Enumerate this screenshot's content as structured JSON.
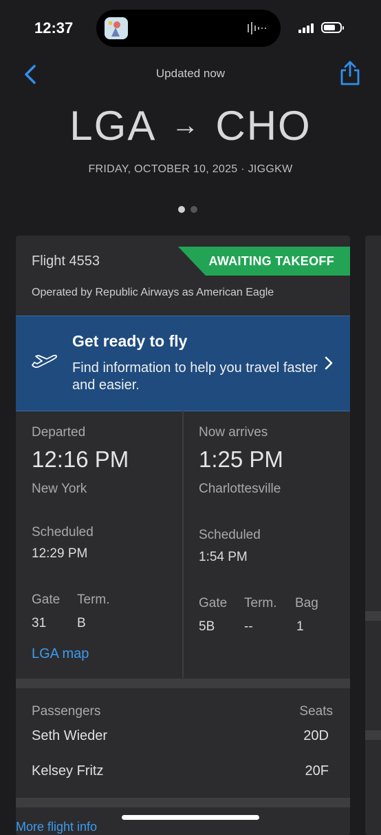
{
  "status_bar": {
    "time": "12:37"
  },
  "header": {
    "updated": "Updated now",
    "origin": "LGA",
    "arrow": "→",
    "destination": "CHO",
    "date_line": "FRIDAY, OCTOBER 10, 2025 · JIGGKW",
    "page_count": 2,
    "active_page": 1
  },
  "flight": {
    "number": "Flight 4553",
    "status": "AWAITING TAKEOFF",
    "status_color": "#23a455",
    "operated_by": "Operated by Republic Airways as American Eagle"
  },
  "promo": {
    "title": "Get ready to fly",
    "text": "Find information to help you travel faster and easier.",
    "icon": "airplane-takeoff-icon",
    "background": "#1f4b7e"
  },
  "departure": {
    "label": "Departed",
    "time": "12:16 PM",
    "city": "New York",
    "scheduled_label": "Scheduled",
    "scheduled_time": "12:29 PM",
    "gate_label": "Gate",
    "gate": "31",
    "term_label": "Term.",
    "term": "B",
    "map_link": "LGA map"
  },
  "arrival": {
    "label": "Now arrives",
    "time": "1:25 PM",
    "city": "Charlottesville",
    "scheduled_label": "Scheduled",
    "scheduled_time": "1:54 PM",
    "gate_label": "Gate",
    "gate": "5B",
    "term_label": "Term.",
    "term": "--",
    "bag_label": "Bag",
    "bag": "1"
  },
  "passengers": {
    "header": "Passengers",
    "seats_header": "Seats",
    "list": [
      {
        "name": "Seth Wieder",
        "seat": "20D"
      },
      {
        "name": "Kelsey Fritz",
        "seat": "20F"
      }
    ]
  },
  "footer": {
    "more_info": "More flight info"
  },
  "colors": {
    "link": "#3b9bf0",
    "background": "#1c1c1e",
    "card": "#2c2c2e"
  }
}
